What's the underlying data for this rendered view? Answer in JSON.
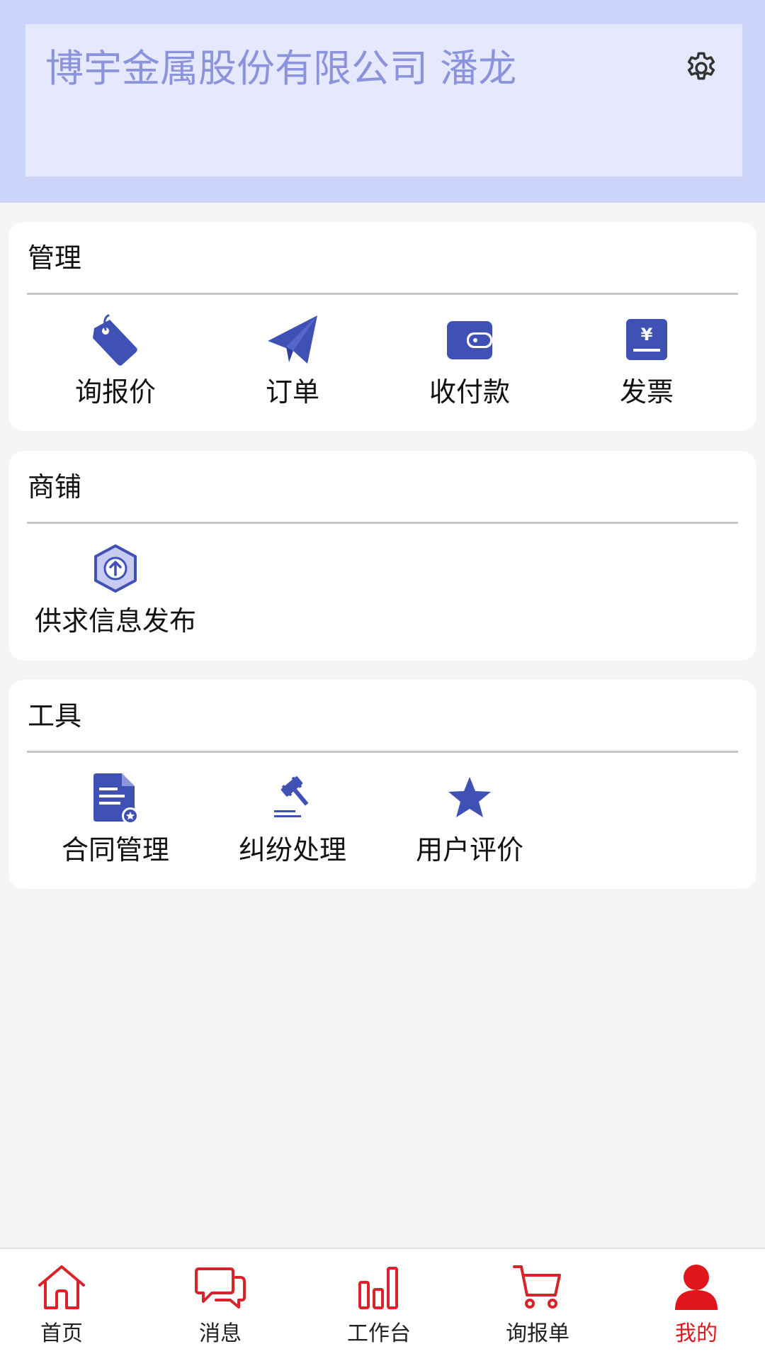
{
  "header": {
    "profile_name": "博宇金属股份有限公司 潘龙",
    "settings_icon": "gear-icon"
  },
  "colors": {
    "accent": "#3f51b5",
    "header_bg": "#ccd4fa",
    "card_bg": "#e6e8fd",
    "tab_red": "#e1161c"
  },
  "sections": {
    "management": {
      "title": "管理",
      "items": [
        {
          "label": "询报价",
          "icon": "price-tag-icon"
        },
        {
          "label": "订单",
          "icon": "paper-plane-icon"
        },
        {
          "label": "收付款",
          "icon": "wallet-icon"
        },
        {
          "label": "发票",
          "icon": "invoice-yen-icon"
        }
      ]
    },
    "shop": {
      "title": "商铺",
      "items": [
        {
          "label": "供求信息发布",
          "icon": "upload-hexagon-icon"
        }
      ]
    },
    "tools": {
      "title": "工具",
      "items": [
        {
          "label": "合同管理",
          "icon": "contract-document-icon"
        },
        {
          "label": "纠纷处理",
          "icon": "gavel-icon"
        },
        {
          "label": "用户评价",
          "icon": "star-icon"
        }
      ]
    }
  },
  "tabbar": {
    "items": [
      {
        "label": "首页",
        "icon": "home-icon"
      },
      {
        "label": "消息",
        "icon": "message-icon"
      },
      {
        "label": "工作台",
        "icon": "bar-chart-icon"
      },
      {
        "label": "询报单",
        "icon": "cart-icon"
      },
      {
        "label": "我的",
        "icon": "user-icon",
        "active": true
      }
    ]
  }
}
